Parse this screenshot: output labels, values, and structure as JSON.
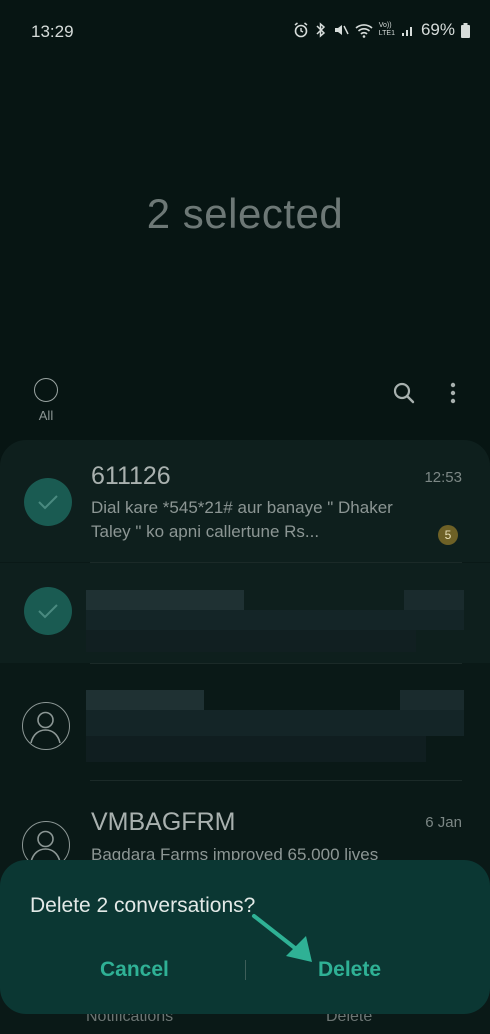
{
  "status_bar": {
    "time": "13:29",
    "battery": "69%",
    "network_label_top": "Vo))",
    "network_label_bottom": "LTE1"
  },
  "header": {
    "title": "2 selected",
    "select_all_label": "All"
  },
  "conversations": [
    {
      "name": "611126",
      "time": "12:53",
      "preview": "Dial kare *545*21# aur banaye \" Dhaker Taley \" ko apni callertune Rs...",
      "unread": "5",
      "selected": true
    },
    {
      "name": "",
      "time": "",
      "preview": "",
      "selected": true
    },
    {
      "name": "",
      "time": "",
      "preview": "",
      "selected": false
    },
    {
      "name": "VMBAGFRM",
      "time": "6 Jan",
      "preview": "Bagdara Farms improved 65,000 lives",
      "selected": false
    }
  ],
  "bottom_actions": {
    "notifications": "Notifications",
    "delete": "Delete"
  },
  "dialog": {
    "message": "Delete 2 conversations?",
    "cancel_label": "Cancel",
    "delete_label": "Delete"
  },
  "colors": {
    "background": "#071513",
    "accent": "#2fb195",
    "dialog": "#0b3733",
    "selected_check": "#1a5b52",
    "badge": "#6e6126"
  }
}
